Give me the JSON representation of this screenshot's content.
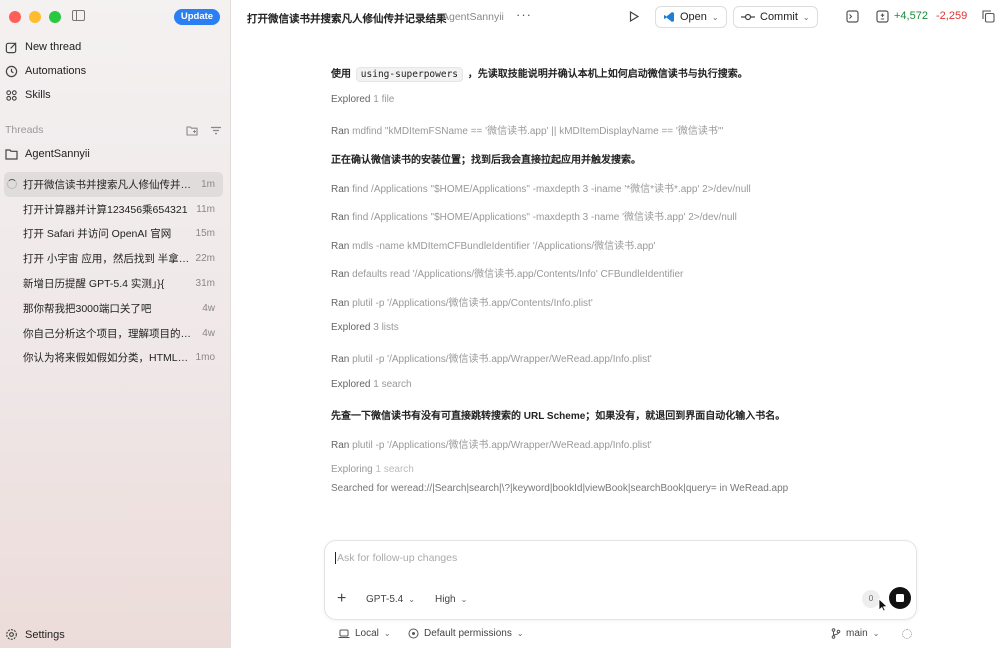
{
  "sidebar": {
    "update_label": "Update",
    "nav": [
      {
        "label": "New thread",
        "icon": "compose-icon"
      },
      {
        "label": "Automations",
        "icon": "clock-icon"
      },
      {
        "label": "Skills",
        "icon": "grid-icon"
      }
    ],
    "threads_label": "Threads",
    "folder": "AgentSannyii",
    "threads": [
      {
        "title": "打开微信读书并搜索凡人修仙传并记...",
        "age": "1m"
      },
      {
        "title": "打开计算器并计算123456乘654321",
        "age": "11m"
      },
      {
        "title": "打开 Safari 并访问 OpenAI 官网",
        "age": "15m"
      },
      {
        "title": "打开 小宇宙 应用，然后找到 半拿铁...",
        "age": "22m"
      },
      {
        "title": "新增日历提醒 GPT-5.4 实测」}{",
        "age": "31m"
      },
      {
        "title": "那你帮我把3000端口关了吧",
        "age": "4w"
      },
      {
        "title": "你自己分析这个项目，理解项目的核...",
        "age": "4w"
      },
      {
        "title": "你认为将来假如假如分类，HTML文...",
        "age": "1mo"
      }
    ],
    "settings_label": "Settings"
  },
  "topbar": {
    "title": "打开微信读书并搜索凡人修仙传并记录结果",
    "project": "AgentSannyii",
    "more": "···",
    "open_label": "Open",
    "commit_label": "Commit",
    "additions": "+4,572",
    "deletions": "-2,259"
  },
  "conversation": {
    "prompt_before": "使用",
    "prompt_code": "using-superpowers",
    "prompt_after": "，先读取技能说明并确认本机上如何启动微信读书与执行搜索。",
    "steps": [
      {
        "type": "explored",
        "k": "Explored",
        "v": "1 file"
      },
      {
        "type": "ran",
        "k": "Ran",
        "v": "mdfind \"kMDItemFSName == '微信读书.app' || kMDItemDisplayName == '微信读书'\""
      },
      {
        "type": "note",
        "v": "正在确认微信读书的安装位置；找到后我会直接拉起应用并触发搜索。"
      },
      {
        "type": "ran",
        "k": "Ran",
        "v": "find /Applications \"$HOME/Applications\" -maxdepth 3 -iname '*微信*读书*.app' 2>/dev/null"
      },
      {
        "type": "ran",
        "k": "Ran",
        "v": "find /Applications \"$HOME/Applications\" -maxdepth 3 -name '微信读书.app' 2>/dev/null"
      },
      {
        "type": "ran",
        "k": "Ran",
        "v": "mdls -name kMDItemCFBundleIdentifier '/Applications/微信读书.app'"
      },
      {
        "type": "ran",
        "k": "Ran",
        "v": "defaults read '/Applications/微信读书.app/Contents/Info' CFBundleIdentifier"
      },
      {
        "type": "ran",
        "k": "Ran",
        "v": "plutil -p '/Applications/微信读书.app/Contents/Info.plist'"
      },
      {
        "type": "explored",
        "k": "Explored",
        "v": "3 lists"
      },
      {
        "type": "ran",
        "k": "Ran",
        "v": "plutil -p '/Applications/微信读书.app/Wrapper/WeRead.app/Info.plist'"
      },
      {
        "type": "explored",
        "k": "Explored",
        "v": "1 search"
      },
      {
        "type": "note",
        "v": "先查一下微信读书有没有可直接跳转搜索的 URL Scheme；如果没有，就退回到界面自动化输入书名。"
      },
      {
        "type": "ran",
        "k": "Ran",
        "v": "plutil -p '/Applications/微信读书.app/Wrapper/WeRead.app/Info.plist'"
      },
      {
        "type": "explored",
        "k": "Exploring",
        "v": "1 search"
      }
    ],
    "searched": "Searched for weread://|Search|search|\\?|keyword|bookId|viewBook|searchBook|query= in WeRead.app"
  },
  "composer": {
    "placeholder": "Ask for follow-up changes",
    "model": "GPT-5.4",
    "effort": "High",
    "counter": "0"
  },
  "footer": {
    "env": "Local",
    "permissions": "Default permissions",
    "branch": "main"
  },
  "colors": {
    "accent": "#2a7ff3",
    "added": "#1a8a3a",
    "removed": "#dd3333"
  }
}
